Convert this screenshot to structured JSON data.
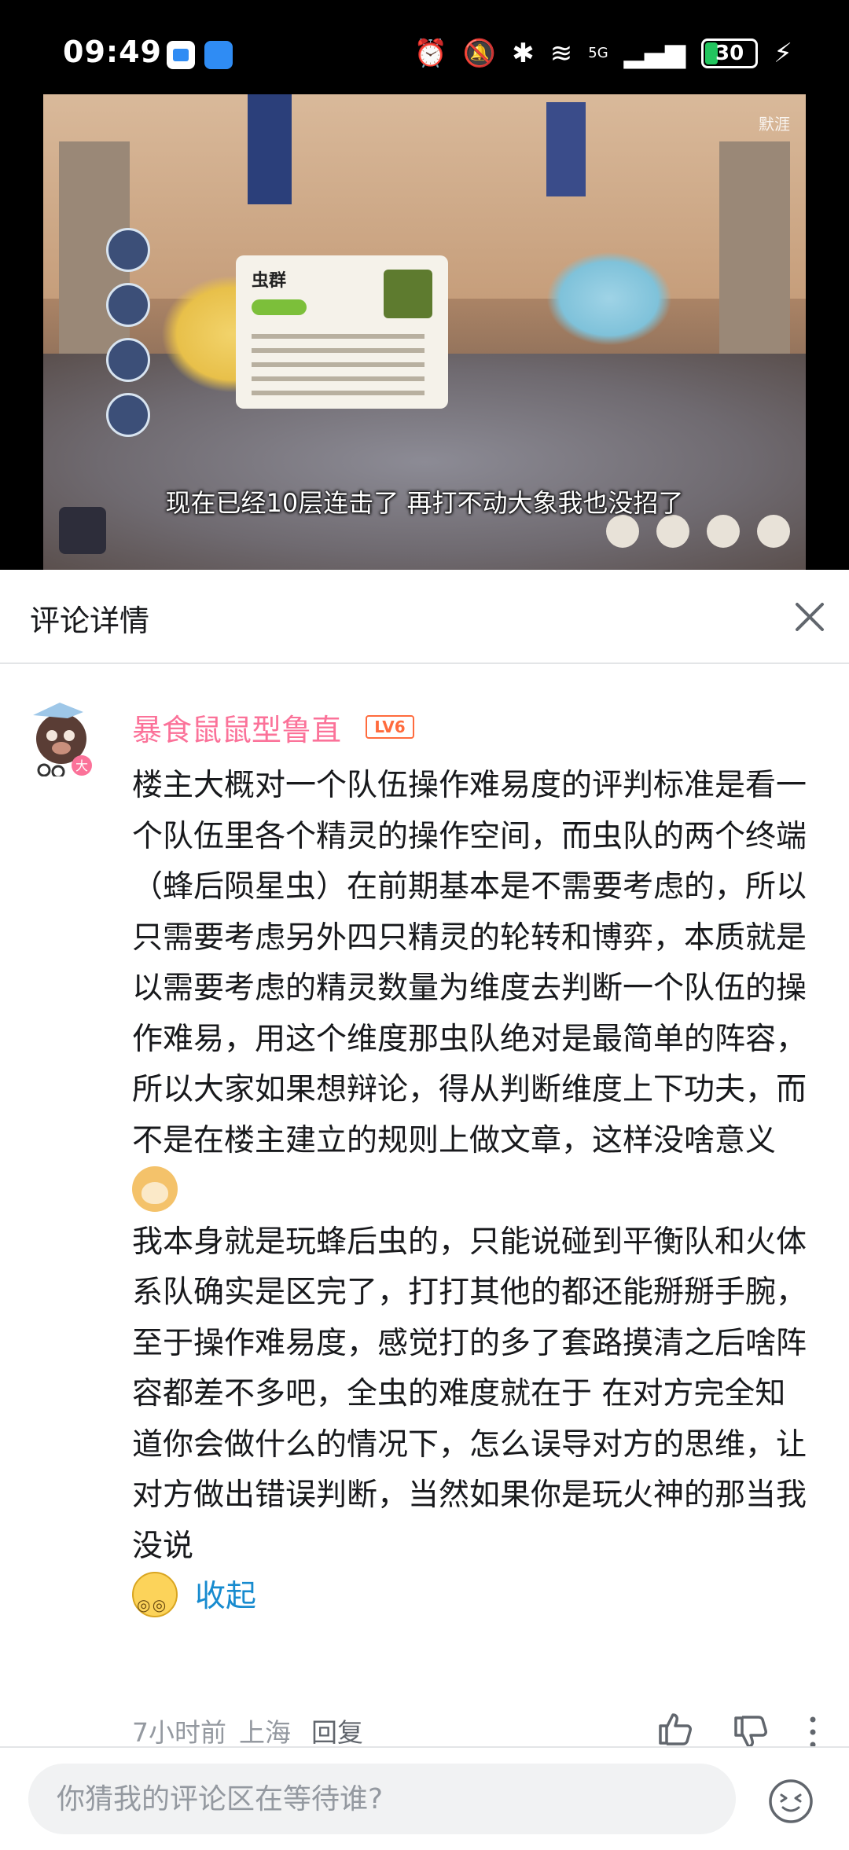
{
  "status_bar": {
    "time": "09:49",
    "network": "5G",
    "battery": "30",
    "battery_level": 0.3
  },
  "video": {
    "subtitle": "现在已经10层连击了 再打不动大象我也没招了",
    "watermark": "默涯",
    "card_title": "虫群",
    "progress": 0.8,
    "accent_color": "#fb7299"
  },
  "panel": {
    "title": "评论详情"
  },
  "comment": {
    "username": "暴食鼠鼠型鲁直",
    "level": "LV6",
    "paragraph1": "楼主大概对一个队伍操作难易度的评判标准是看一个队伍里各个精灵的操作空间，而虫队的两个终端（蜂后陨星虫）在前期基本是不需要考虑的，所以只需要考虑另外四只精灵的轮转和博弈，本质就是以需要考虑的精灵数量为维度去判断一个队伍的操作难易，用这个维度那虫队绝对是最简单的阵容，所以大家如果想辩论，得从判断维度上下功夫，而不是在楼主建立的规则上做文章，这样没啥意义",
    "paragraph2": "我本身就是玩蜂后虫的，只能说碰到平衡队和火体系队确实是区完了，打打其他的都还能掰掰手腕，至于操作难易度，感觉打的多了套路摸清之后啥阵容都差不多吧，全虫的难度就在于 在对方完全知道你会做什么的情况下，怎么误导对方的思维，让对方做出错误判断，当然如果你是玩火神的那当我没说",
    "collapse_label": "收起",
    "time": "7小时前",
    "location": "上海",
    "reply_label": "回复",
    "name_color": "#fb7299",
    "link_color": "#178bcf"
  },
  "input": {
    "placeholder": "你猜我的评论区在等待谁?"
  },
  "icons": {
    "close": "close-icon",
    "like": "thumbs-up-icon",
    "dislike": "thumbs-down-icon",
    "more": "more-vertical-icon",
    "emoji": "emoji-face-icon"
  }
}
